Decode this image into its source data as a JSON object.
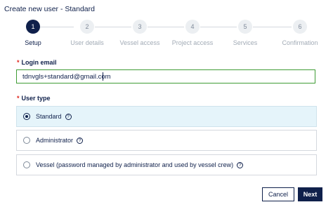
{
  "header": {
    "title": "Create new user - Standard"
  },
  "stepper": {
    "steps": [
      {
        "number": "1",
        "label": "Setup",
        "active": true
      },
      {
        "number": "2",
        "label": "User details",
        "active": false
      },
      {
        "number": "3",
        "label": "Vessel access",
        "active": false
      },
      {
        "number": "4",
        "label": "Project access",
        "active": false
      },
      {
        "number": "5",
        "label": "Services",
        "active": false
      },
      {
        "number": "6",
        "label": "Confirmation",
        "active": false
      }
    ]
  },
  "form": {
    "required_marker": "*",
    "login_email": {
      "label": "Login email",
      "value": "tdnvgls+standard@gmail.com"
    },
    "user_type": {
      "label": "User type",
      "selected": "Standard",
      "options": [
        {
          "label": "Standard",
          "help": "?"
        },
        {
          "label": "Administrator",
          "help": "?"
        },
        {
          "label": "Vessel (password managed by administrator and used by vessel crew)",
          "help": "?"
        }
      ]
    }
  },
  "footer": {
    "cancel_label": "Cancel",
    "next_label": "Next"
  },
  "colors": {
    "primary": "#0f204b",
    "selected_bg": "#e5f4fa",
    "focus_border": "#3f9c35",
    "required": "#e0231b"
  }
}
